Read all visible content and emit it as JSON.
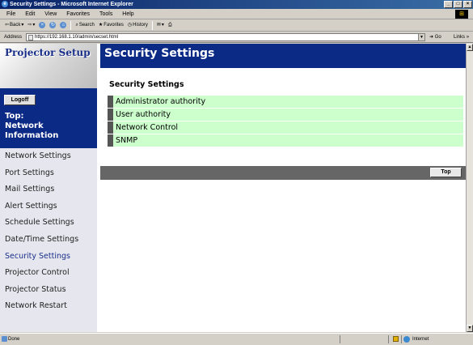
{
  "window": {
    "title": "Security Settings - Microsoft Internet Explorer",
    "controls": [
      "_",
      "□",
      "×"
    ]
  },
  "menubar": {
    "items": [
      "File",
      "Edit",
      "View",
      "Favorites",
      "Tools",
      "Help"
    ]
  },
  "toolbar": {
    "back": "Back",
    "search": "Search",
    "favorites": "Favorites",
    "history": "History"
  },
  "addressbar": {
    "label": "Address",
    "url": "https://192.168.1.10/admin/secset.html",
    "go": "Go",
    "links": "Links"
  },
  "sidebar": {
    "title": "Projector Setup",
    "logoff": "Logoff",
    "top_label": "Top:\nNetwork\nInformation",
    "top_label_lines": [
      "Top:",
      "Network",
      "Information"
    ],
    "items": [
      {
        "label": "Network Settings",
        "active": false
      },
      {
        "label": "Port Settings",
        "active": false
      },
      {
        "label": "Mail Settings",
        "active": false
      },
      {
        "label": "Alert Settings",
        "active": false
      },
      {
        "label": "Schedule Settings",
        "active": false
      },
      {
        "label": "Date/Time Settings",
        "active": false
      },
      {
        "label": "Security Settings",
        "active": true
      },
      {
        "label": "Projector Control",
        "active": false
      },
      {
        "label": "Projector Status",
        "active": false
      },
      {
        "label": "Network Restart",
        "active": false
      }
    ]
  },
  "main": {
    "header": "Security Settings",
    "section_title": "Security Settings",
    "menu": [
      "Administrator authority",
      "User authority",
      "Network Control",
      "SNMP"
    ],
    "top_button": "Top"
  },
  "statusbar": {
    "text": "Done",
    "zone": "Internet"
  },
  "colors": {
    "nav_blue": "#0b2a85",
    "menu_green": "#ccffcc",
    "bar_gray": "#666666"
  }
}
